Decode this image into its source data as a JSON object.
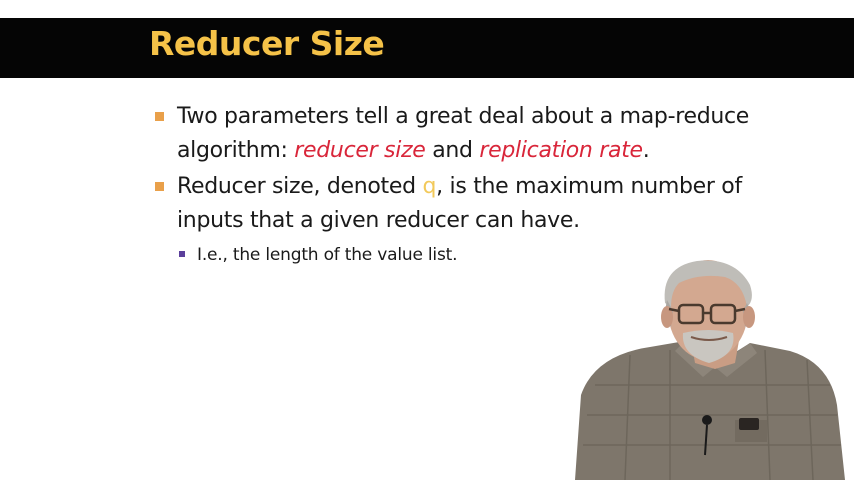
{
  "slide": {
    "title": "Reducer Size",
    "bullets": [
      {
        "part1": "Two parameters tell a great deal about a map-reduce algorithm: ",
        "emph1": "reducer size",
        "part2": " and ",
        "emph2": "replication rate",
        "part3": "."
      },
      {
        "part1": "Reducer size, denoted ",
        "var": "q",
        "part2": ", is the maximum number of inputs that a given reducer can have."
      }
    ],
    "sub_bullets": [
      {
        "text": "I.e., the length of the value list."
      }
    ]
  },
  "colors": {
    "title_bar": "#050505",
    "title_text": "#f5c248",
    "bullet_marker": "#e9a04a",
    "sub_bullet_marker": "#5b3f9b",
    "emphasis": "#d9263a",
    "variable": "#f2c95a"
  }
}
